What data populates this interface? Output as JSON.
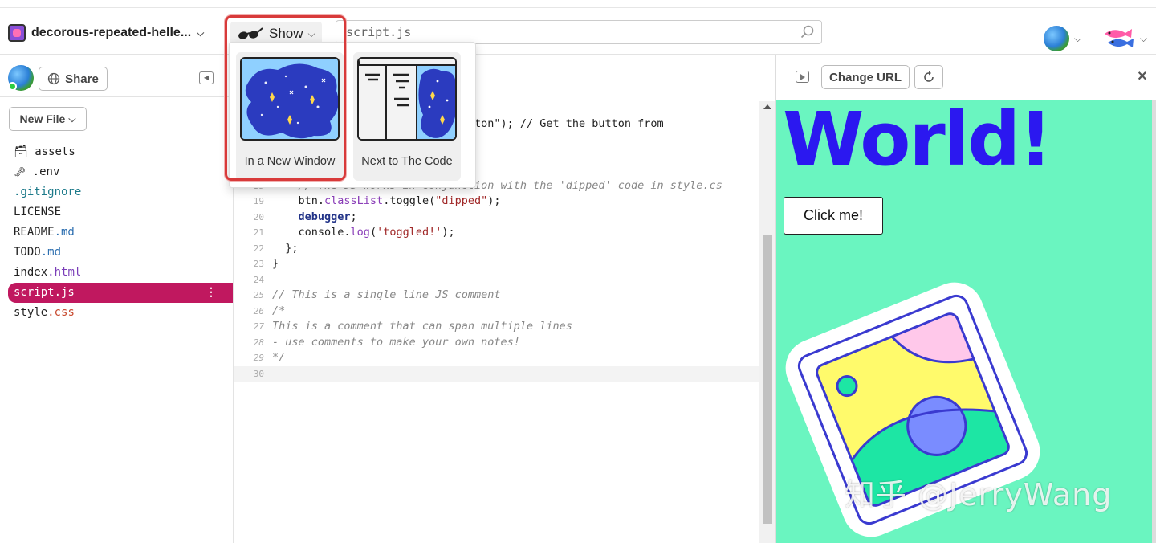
{
  "header": {
    "project_name": "decorous-repeated-helle...",
    "show_label": "Show",
    "search_value": "script.js"
  },
  "show_menu": {
    "options": [
      {
        "label": "In a New Window"
      },
      {
        "label": "Next to The Code"
      }
    ]
  },
  "sidebar": {
    "share_label": "Share",
    "new_file_label": "New File",
    "files": [
      {
        "name": "assets",
        "ext": ""
      },
      {
        "name": ".env",
        "ext": ""
      },
      {
        "name": ".gitignore",
        "ext": ""
      },
      {
        "name": "LICENSE",
        "ext": ""
      },
      {
        "name": "README",
        "ext": ".md"
      },
      {
        "name": "TODO",
        "ext": ".md"
      },
      {
        "name": "index",
        "ext": ".html"
      },
      {
        "name": "script.js",
        "ext": ""
      },
      {
        "name": "style",
        "ext": ".css"
      }
    ],
    "active_file": "script.js"
  },
  "editor": {
    "visible_fragments": {
      "frag1": "lector(\"button\"); // Get the button from",
      "frag2": "on",
      "frag3": "// The JS works in conjunction with the 'dipped' code in style.cs"
    },
    "lines": [
      {
        "n": "19",
        "pre": "    btn.",
        "fn": "classList",
        "post": ".toggle(",
        "str": "\"dipped\"",
        "end": ");"
      },
      {
        "n": "20",
        "kw": "debugger",
        "end": ";"
      },
      {
        "n": "21",
        "pre": "    console.",
        "fn": "log",
        "post": "(",
        "str": "'toggled!'",
        "end": ");"
      },
      {
        "n": "22",
        "code": "  };"
      },
      {
        "n": "23",
        "code": "}"
      },
      {
        "n": "24",
        "code": ""
      },
      {
        "n": "25",
        "comment": "// This is a single line JS comment"
      },
      {
        "n": "26",
        "comment": "/*"
      },
      {
        "n": "27",
        "comment": "This is a comment that can span multiple lines"
      },
      {
        "n": "28",
        "comment": "- use comments to make your own notes!"
      },
      {
        "n": "29",
        "comment": "*/"
      },
      {
        "n": "30",
        "code": ""
      }
    ]
  },
  "preview": {
    "change_url_label": "Change URL",
    "heading": "World!",
    "button_label": "Click me!"
  },
  "watermark": "知乎 @JerryWang"
}
